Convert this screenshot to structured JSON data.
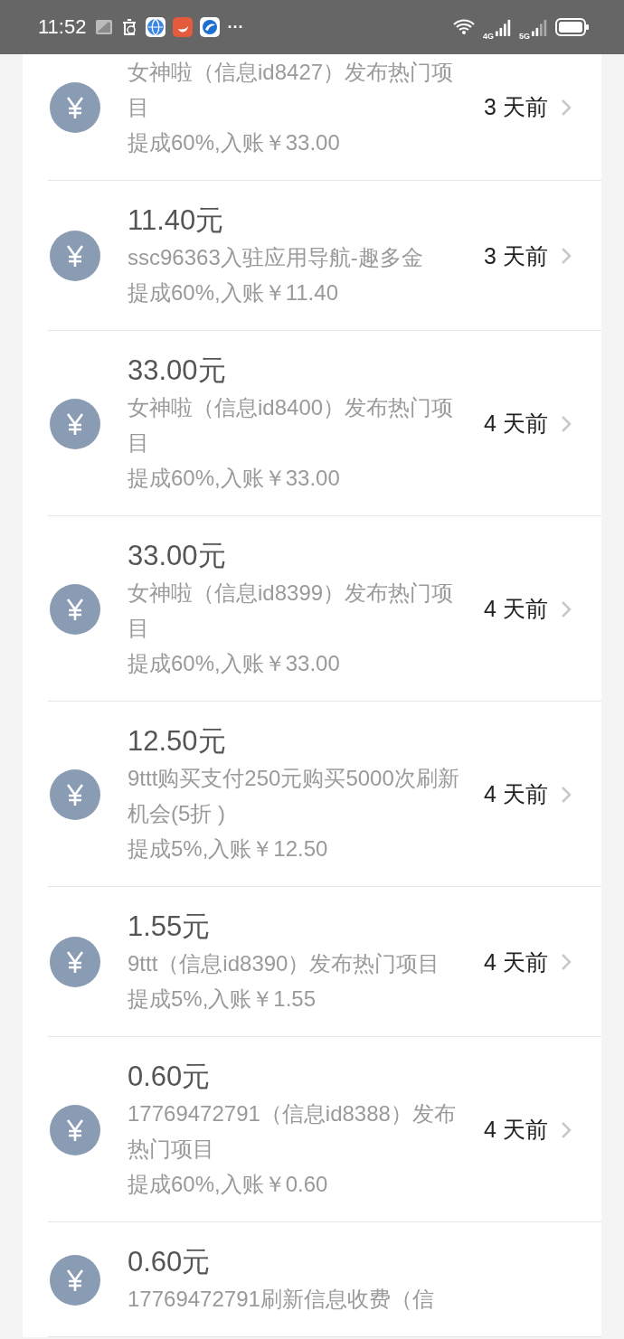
{
  "status_bar": {
    "time": "11:52",
    "more": "···",
    "network_1": "4G",
    "network_2": "5G"
  },
  "records": [
    {
      "description": "女神啦（信息id8427）发布热门项目",
      "time": "3 天前",
      "commission": "提成60%,入账￥33.00"
    },
    {
      "amount": "11.40元",
      "description": "ssc96363入驻应用导航-趣多金",
      "time": "3 天前",
      "commission": "提成60%,入账￥11.40"
    },
    {
      "amount": "33.00元",
      "description": "女神啦（信息id8400）发布热门项目",
      "time": "4 天前",
      "commission": "提成60%,入账￥33.00"
    },
    {
      "amount": "33.00元",
      "description": "女神啦（信息id8399）发布热门项目",
      "time": "4 天前",
      "commission": "提成60%,入账￥33.00"
    },
    {
      "amount": "12.50元",
      "description": "9ttt购买支付250元购买5000次刷新机会(5折 )",
      "time": "4 天前",
      "commission": "提成5%,入账￥12.50"
    },
    {
      "amount": "1.55元",
      "description": "9ttt（信息id8390）发布热门项目",
      "time": "4 天前",
      "commission": "提成5%,入账￥1.55"
    },
    {
      "amount": "0.60元",
      "description": "17769472791（信息id8388）发布热门项目",
      "time": "4 天前",
      "commission": "提成60%,入账￥0.60"
    },
    {
      "amount": "0.60元",
      "description": "17769472791刷新信息收费（信"
    }
  ]
}
